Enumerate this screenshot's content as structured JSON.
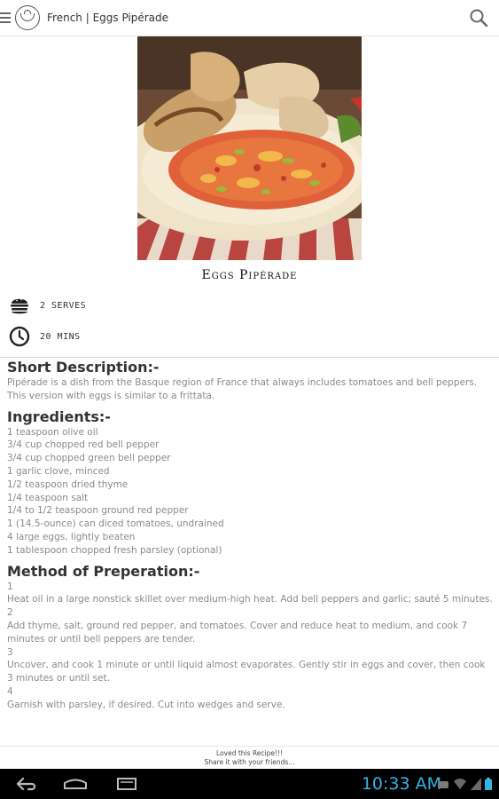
{
  "header": {
    "title": "French | Eggs Pipérade"
  },
  "recipe": {
    "title": "Eggs Pipérade",
    "serves": "2 SERVES",
    "time": "20 MINS"
  },
  "description": {
    "heading": "Short Description:-",
    "text": "Pipérade is a dish from the Basque region of France that always includes tomatoes and bell peppers. This version with eggs is similar to a frittata."
  },
  "ingredients": {
    "heading": "Ingredients:-",
    "items": [
      "1 teaspoon olive oil",
      "3/4 cup chopped red bell pepper",
      "3/4 cup chopped green bell pepper",
      "1 garlic clove, minced",
      "1/2 teaspoon dried thyme",
      "1/4 teaspoon salt",
      "1/4 to 1/2 teaspoon ground red pepper",
      "1 (14.5-ounce) can diced tomatoes, undrained",
      "4 large eggs, lightly beaten",
      "1 tablespoon chopped fresh parsley (optional)"
    ]
  },
  "method": {
    "heading": "Method of Preperation:-",
    "steps": [
      {
        "num": "1",
        "text": "Heat oil in a large nonstick skillet over medium-high heat. Add bell peppers and garlic; sauté 5 minutes."
      },
      {
        "num": "2",
        "text": "Add thyme, salt, ground red pepper, and tomatoes. Cover and reduce heat to medium, and cook 7 minutes or until bell peppers are tender."
      },
      {
        "num": "3",
        "text": "Uncover, and cook 1 minute or until liquid almost evaporates. Gently stir in eggs and cover, then cook 3 minutes or until set."
      },
      {
        "num": "4",
        "text": "Garnish with parsley, if desired. Cut into wedges and serve."
      }
    ]
  },
  "footer": {
    "line1": "Loved this Recipe!!!",
    "line2": "Share it with your friends..."
  },
  "system": {
    "time": "10:33 AM"
  },
  "colors": {
    "clock": "#33b5e5",
    "navbar": "#000000"
  }
}
